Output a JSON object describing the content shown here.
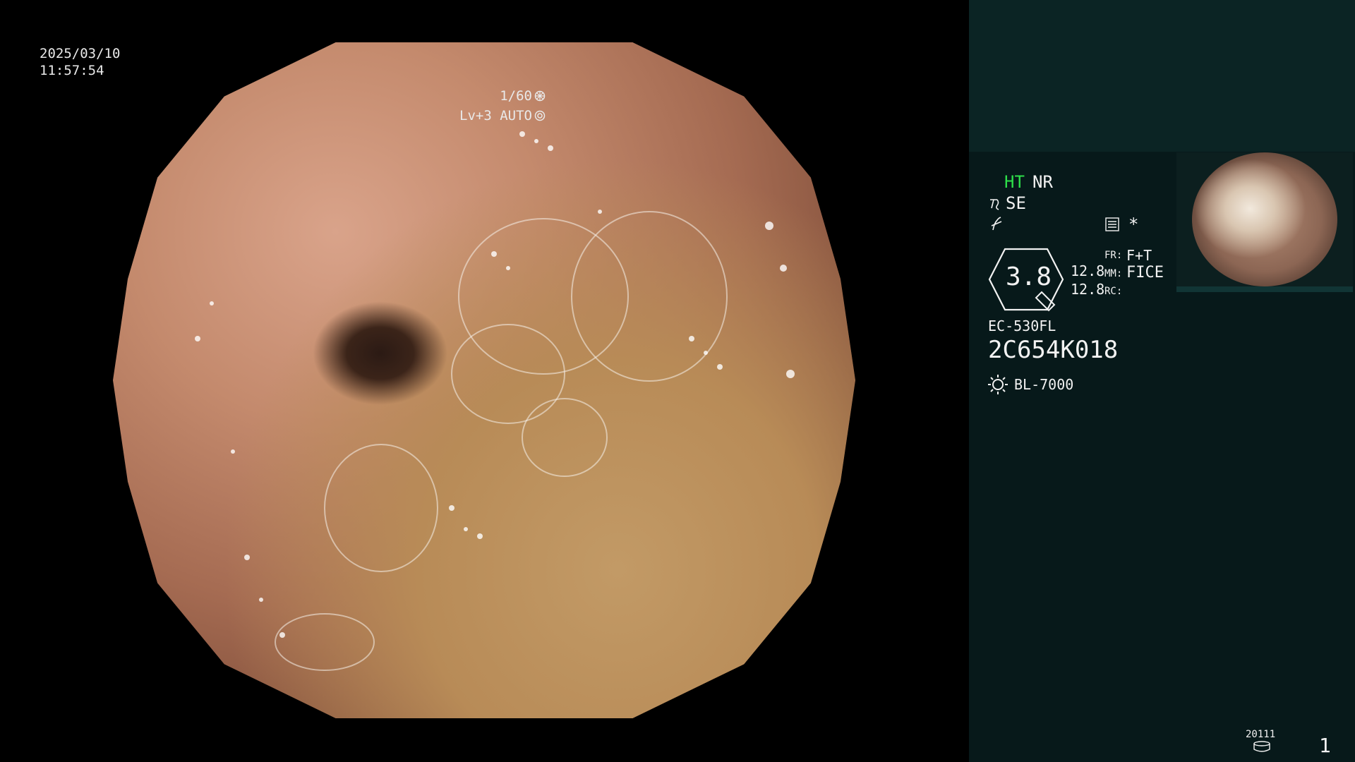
{
  "overlay": {
    "date": "2025/03/10",
    "time": "11:57:54",
    "shutter": "1/60",
    "level": "Lv+3 AUTO"
  },
  "panel": {
    "ht": "HT",
    "nr": "NR",
    "se": "SE",
    "star": "*",
    "index_value": "3.8",
    "value_1": "12.8",
    "value_2": "12.8",
    "fr_label": "FR:",
    "fr_value": "F+T",
    "mm_label": "MM:",
    "mm_value": "FICE",
    "rc_label": "RC:",
    "scope_model": "EC-530FL",
    "scope_serial": "2C654K018",
    "light_source": "BL-7000",
    "counter": "20111",
    "page_number": "1"
  },
  "icons": {
    "shutter": "aperture-icon",
    "level": "iris-icon",
    "se": "se-mode-icon",
    "noise": "noise-reduction-icon",
    "settings": "settings-list-icon",
    "index": "index-hexagon-icon",
    "light": "sun-icon",
    "storage": "disk-icon"
  },
  "colors": {
    "ht_green": "#2ee04a",
    "panel_bg": "#07191a",
    "panel_top": "#0b2424"
  }
}
